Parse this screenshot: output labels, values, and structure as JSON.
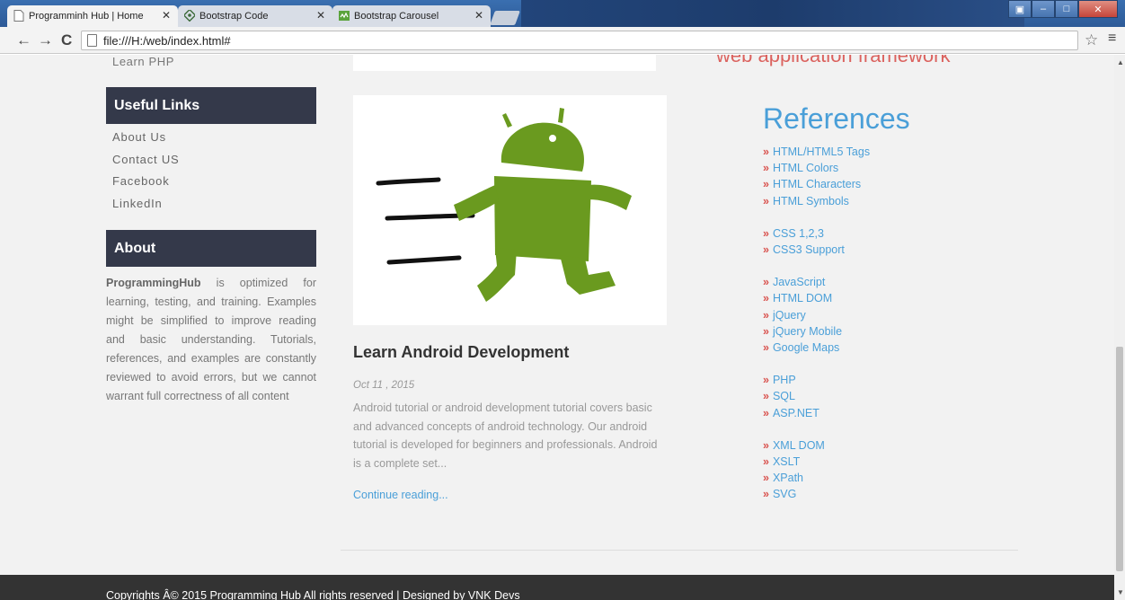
{
  "browser": {
    "tabs": [
      {
        "title": "Programminh Hub | Home",
        "icon": "page-icon"
      },
      {
        "title": "Bootstrap Code",
        "icon": "bootstrap-icon"
      },
      {
        "title": "Bootstrap Carousel",
        "icon": "carousel-icon"
      }
    ],
    "url": "file:///H:/web/index.html#"
  },
  "sidebar": {
    "learn_php": "Learn PHP",
    "useful_links_heading": "Useful Links",
    "useful_links": [
      "About Us",
      "Contact US",
      "Facebook",
      "LinkedIn"
    ],
    "about_heading": "About",
    "about_brand": "ProgrammingHub",
    "about_text": " is optimized for learning, testing, and training. Examples might be simplified to improve reading and basic understanding. Tutorials, references, and examples are constantly reviewed to avoid errors, but we cannot warrant full correctness of all content"
  },
  "post": {
    "title": "Learn Android Development",
    "date": "Oct 11 , 2015",
    "excerpt": "Android tutorial or android development tutorial covers basic and advanced concepts of android technology. Our android tutorial is developed for beginners and professionals. Android is a complete set...",
    "continue_label": "Continue reading..."
  },
  "references": {
    "banner_text": "web application framework",
    "title": "References",
    "groups": [
      [
        "HTML/HTML5 Tags",
        "HTML Colors",
        "HTML Characters",
        "HTML Symbols"
      ],
      [
        "CSS 1,2,3",
        "CSS3 Support"
      ],
      [
        "JavaScript",
        "HTML DOM",
        "jQuery",
        "jQuery Mobile",
        "Google Maps"
      ],
      [
        "PHP",
        "SQL",
        "ASP.NET"
      ],
      [
        "XML DOM",
        "XSLT",
        "XPath",
        "SVG"
      ]
    ],
    "bullet": "»"
  },
  "footer": {
    "copyright": "Copyrights Â© 2015 Programming Hub All rights reserved | Designed by VNK Devs"
  },
  "colors": {
    "accent_blue": "#4a9fd8",
    "sidebar_header": "#34394a",
    "android_green": "#6a9a1f",
    "bullet_red": "#d9534f",
    "footer_bg": "#333333"
  }
}
